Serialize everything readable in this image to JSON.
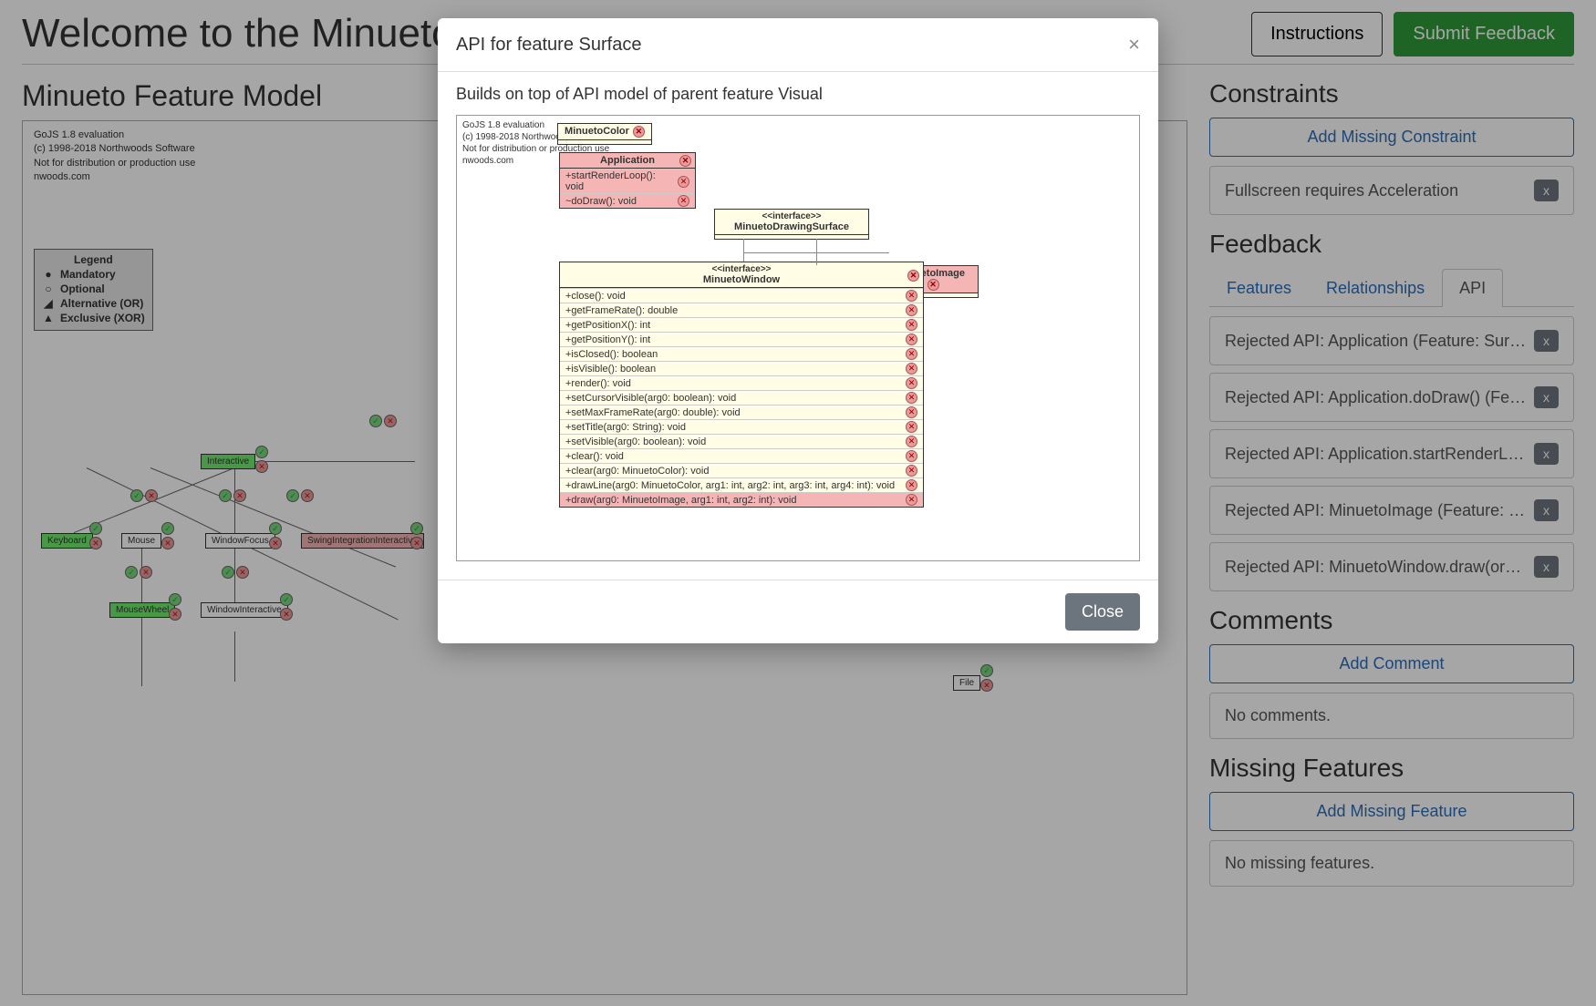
{
  "header": {
    "welcome": "Welcome to the Minueto C",
    "instructions_label": "Instructions",
    "submit_label": "Submit Feedback"
  },
  "feature_model": {
    "title": "Minueto Feature Model",
    "canvas_meta": [
      "GoJS 1.8 evaluation",
      "(c) 1998-2018 Northwoods Software",
      "Not for distribution or production use",
      "nwoods.com"
    ],
    "legend": {
      "title": "Legend",
      "items": [
        "Mandatory",
        "Optional",
        "Alternative (OR)",
        "Exclusive (XOR)"
      ]
    },
    "features": {
      "interactive": "Interactive",
      "keyboard": "Keyboard",
      "mouse": "Mouse",
      "window_focus": "WindowFocus",
      "swing": "SwingIntegrationInteractive",
      "mouse_wheel": "MouseWheel",
      "window_interactive": "WindowInteractive",
      "file": "File"
    }
  },
  "constraints": {
    "heading": "Constraints",
    "add_label": "Add Missing Constraint",
    "items": [
      "Fullscreen requires Acceleration"
    ]
  },
  "feedback": {
    "heading": "Feedback",
    "tabs": {
      "features": "Features",
      "relationships": "Relationships",
      "api": "API"
    },
    "api_items": [
      "Rejected API: Application (Feature: Surface)",
      "Rejected API: Application.doDraw() (Featu...",
      "Rejected API: Application.startRenderLoo...",
      "Rejected API: MinuetoImage (Feature: Sur...",
      "Rejected API: MinuetoWindow.draw(org.m..."
    ]
  },
  "comments": {
    "heading": "Comments",
    "add_label": "Add Comment",
    "empty": "No comments."
  },
  "missing": {
    "heading": "Missing Features",
    "add_label": "Add Missing Feature",
    "empty": "No missing features."
  },
  "modal": {
    "title": "API for feature Surface",
    "desc": "Builds on top of API model of parent feature Visual",
    "close_label": "Close",
    "canvas_meta": [
      "GoJS 1.8 evaluation",
      "(c) 1998-2018 Northwoods Software",
      "Not for distribution or production use",
      "nwoods.com"
    ],
    "classes": {
      "minueto_color": "MinuetoColor",
      "application": "Application",
      "application_methods": [
        "+startRenderLoop(): void",
        "~doDraw(): void"
      ],
      "drawing_surface_stereo": "<<interface>>",
      "drawing_surface": "MinuetoDrawingSurface",
      "minueto_image": "MinuetoImage",
      "window_stereo": "<<interface>>",
      "window": "MinuetoWindow",
      "window_methods": [
        "+close(): void",
        "+getFrameRate(): double",
        "+getPositionX(): int",
        "+getPositionY(): int",
        "+isClosed(): boolean",
        "+isVisible(): boolean",
        "+render(): void",
        "+setCursorVisible(arg0: boolean): void",
        "+setMaxFrameRate(arg0: double): void",
        "+setTitle(arg0: String): void",
        "+setVisible(arg0: boolean): void",
        "+clear(): void",
        "+clear(arg0: MinuetoColor): void",
        "+drawLine(arg0: MinuetoColor, arg1: int, arg2: int, arg3: int, arg4: int): void",
        "+draw(arg0: MinuetoImage, arg1: int, arg2: int): void"
      ],
      "window_pink_row": 14
    }
  },
  "x_label": "x"
}
